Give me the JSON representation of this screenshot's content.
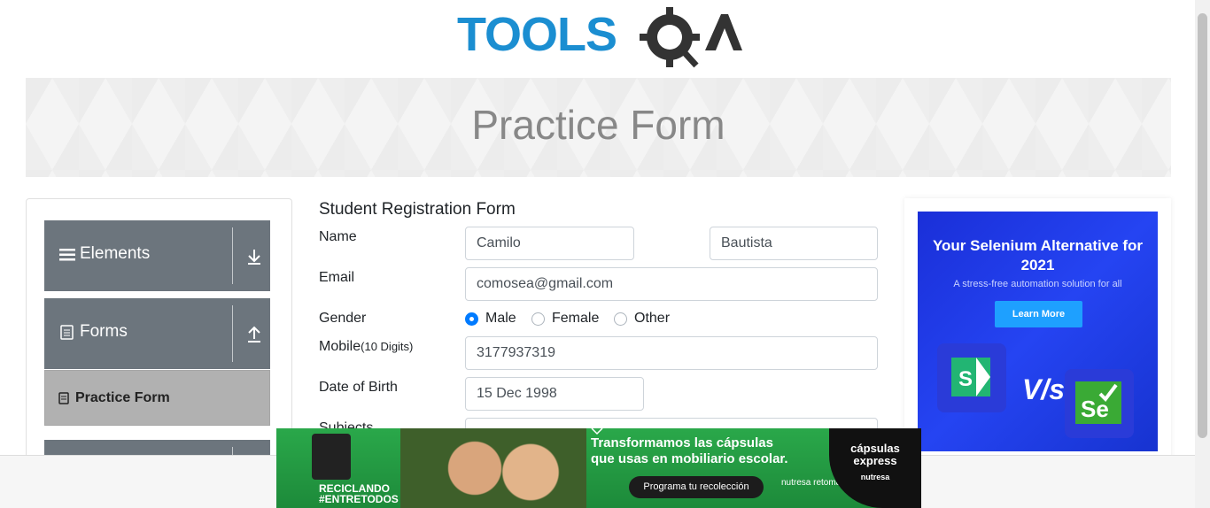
{
  "header": {
    "logo_text": "TOOLSQA",
    "page_title": "Practice Form"
  },
  "sidebar": {
    "groups": [
      {
        "label": "Elements",
        "expanded": false
      },
      {
        "label": "Forms",
        "expanded": true
      }
    ],
    "active_item": "Practice Form"
  },
  "form": {
    "title": "Student Registration Form",
    "name_label": "Name",
    "first_name": "Camilo",
    "last_name": "Bautista",
    "email_label": "Email",
    "email": "comosea@gmail.com",
    "gender_label": "Gender",
    "gender_options": [
      "Male",
      "Female",
      "Other"
    ],
    "gender_selected": "Male",
    "mobile_label": "Mobile",
    "mobile_hint": "(10 Digits)",
    "mobile": "3177937319",
    "dob_label": "Date of Birth",
    "dob": "15 Dec 1998",
    "subjects_label": "Subjects"
  },
  "ad_right": {
    "headline": "Your Selenium Alternative for 2021",
    "sub": "A stress-free automation solution for all",
    "button": "Learn More",
    "vs": "V/s"
  },
  "ad_bottom": {
    "text1": "Transformamos las cápsulas",
    "text2": "que usas en mobiliario escolar.",
    "button": "Programa tu recolección",
    "brand": "cápsulas express",
    "brand_sub": "nutresa",
    "recycle": "RECICLANDO",
    "hashtag": "#ENTRETODOS",
    "logo": "nutresa retoma"
  },
  "colors": {
    "accent": "#007bff",
    "sidebar_group": "#6c757d",
    "active_item": "#b1b1b1"
  }
}
